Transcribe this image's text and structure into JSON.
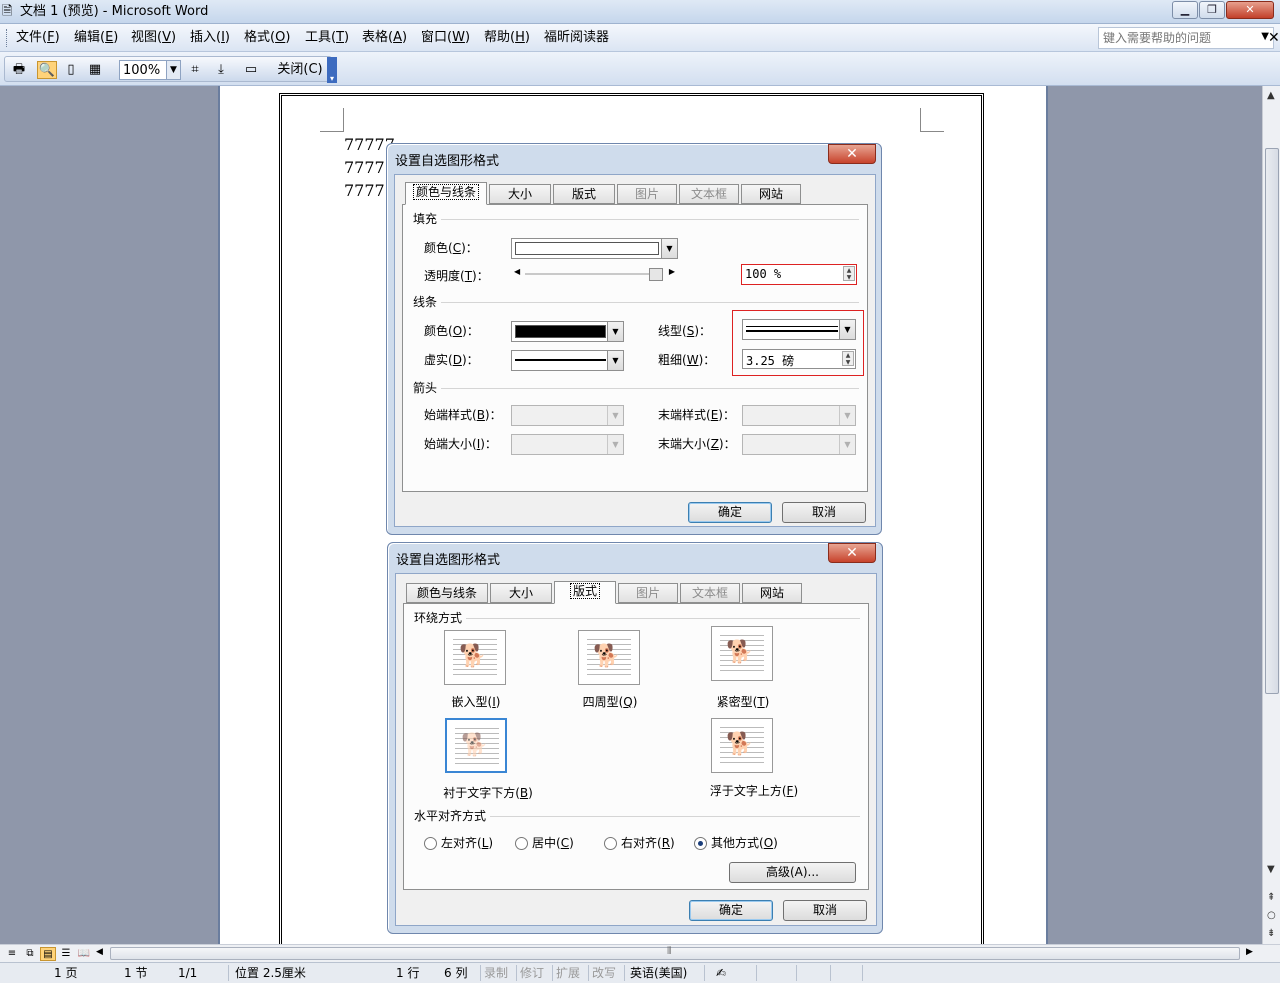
{
  "window": {
    "title": "文档 1 (预览) - Microsoft Word",
    "app_icon": "word-doc-icon",
    "minimize": "▁",
    "restore": "❐",
    "close": "✕"
  },
  "menu": {
    "items": [
      {
        "text": "文件(",
        "key": "F",
        "end": ")"
      },
      {
        "text": "编辑(",
        "key": "E",
        "end": ")"
      },
      {
        "text": "视图(",
        "key": "V",
        "end": ")"
      },
      {
        "text": "插入(",
        "key": "I",
        "end": ")"
      },
      {
        "text": "格式(",
        "key": "O",
        "end": ")"
      },
      {
        "text": "工具(",
        "key": "T",
        "end": ")"
      },
      {
        "text": "表格(",
        "key": "A",
        "end": ")"
      },
      {
        "text": "窗口(",
        "key": "W",
        "end": ")"
      },
      {
        "text": "帮助(",
        "key": "H",
        "end": ")"
      },
      {
        "text": "福昕阅读器",
        "key": "",
        "end": ""
      }
    ],
    "help_placeholder": "键入需要帮助的问题"
  },
  "toolbar": {
    "zoom": "100%",
    "close_label": "关闭(C)"
  },
  "document": {
    "lines": [
      "77777",
      "7777",
      "7777"
    ]
  },
  "dialog1": {
    "title": "设置自选图形格式",
    "tabs": [
      "颜色与线条",
      "大小",
      "版式",
      "图片",
      "文本框",
      "网站"
    ],
    "fill_group": "填充",
    "fill_color_label": "颜色(",
    "fill_color_key": "C",
    "transparency_label": "透明度(",
    "transparency_key": "T",
    "transparency_value": "100 %",
    "transparency_fraction": 1.0,
    "line_group": "线条",
    "line_color_label": "颜色(",
    "line_color_key": "O",
    "line_style_label": "线型(",
    "line_style_key": "S",
    "dash_label": "虚实(",
    "dash_key": "D",
    "weight_label": "粗细(",
    "weight_key": "W",
    "weight_value": "3.25 磅",
    "arrow_group": "箭头",
    "begin_style_label": "始端样式(",
    "begin_style_key": "B",
    "end_style_label": "末端样式(",
    "end_style_key": "E",
    "begin_size_label": "始端大小(",
    "begin_size_key": "I",
    "end_size_label": "末端大小(",
    "end_size_key": "Z",
    "ok": "确定",
    "cancel": "取消",
    "fill_color": "#ffffff",
    "line_color": "#000000"
  },
  "dialog2": {
    "title": "设置自选图形格式",
    "tabs": [
      "颜色与线条",
      "大小",
      "版式",
      "图片",
      "文本框",
      "网站"
    ],
    "wrap_group": "环绕方式",
    "wrap_styles": [
      {
        "label": "嵌入型(",
        "key": "I"
      },
      {
        "label": "四周型(",
        "key": "Q"
      },
      {
        "label": "紧密型(",
        "key": "T"
      },
      {
        "label": "衬于文字下方(",
        "key": "B"
      },
      {
        "label": "浮于文字上方(",
        "key": "F"
      }
    ],
    "align_group": "水平对齐方式",
    "align_options": [
      {
        "label": "左对齐(",
        "key": "L"
      },
      {
        "label": "居中(",
        "key": "C"
      },
      {
        "label": "右对齐(",
        "key": "R"
      },
      {
        "label": "其他方式(",
        "key": "O"
      }
    ],
    "advanced": "高级(A)...",
    "ok": "确定",
    "cancel": "取消",
    "dog_glyph": "🐕"
  },
  "status": {
    "page": "1 页",
    "section": "1 节",
    "pages": "1/1",
    "position": "位置 2.5厘米",
    "line": "1 行",
    "column": "6 列",
    "rec": "录制",
    "trk": "修订",
    "ext": "扩展",
    "ovr": "改写",
    "language": "英语(美国)"
  }
}
